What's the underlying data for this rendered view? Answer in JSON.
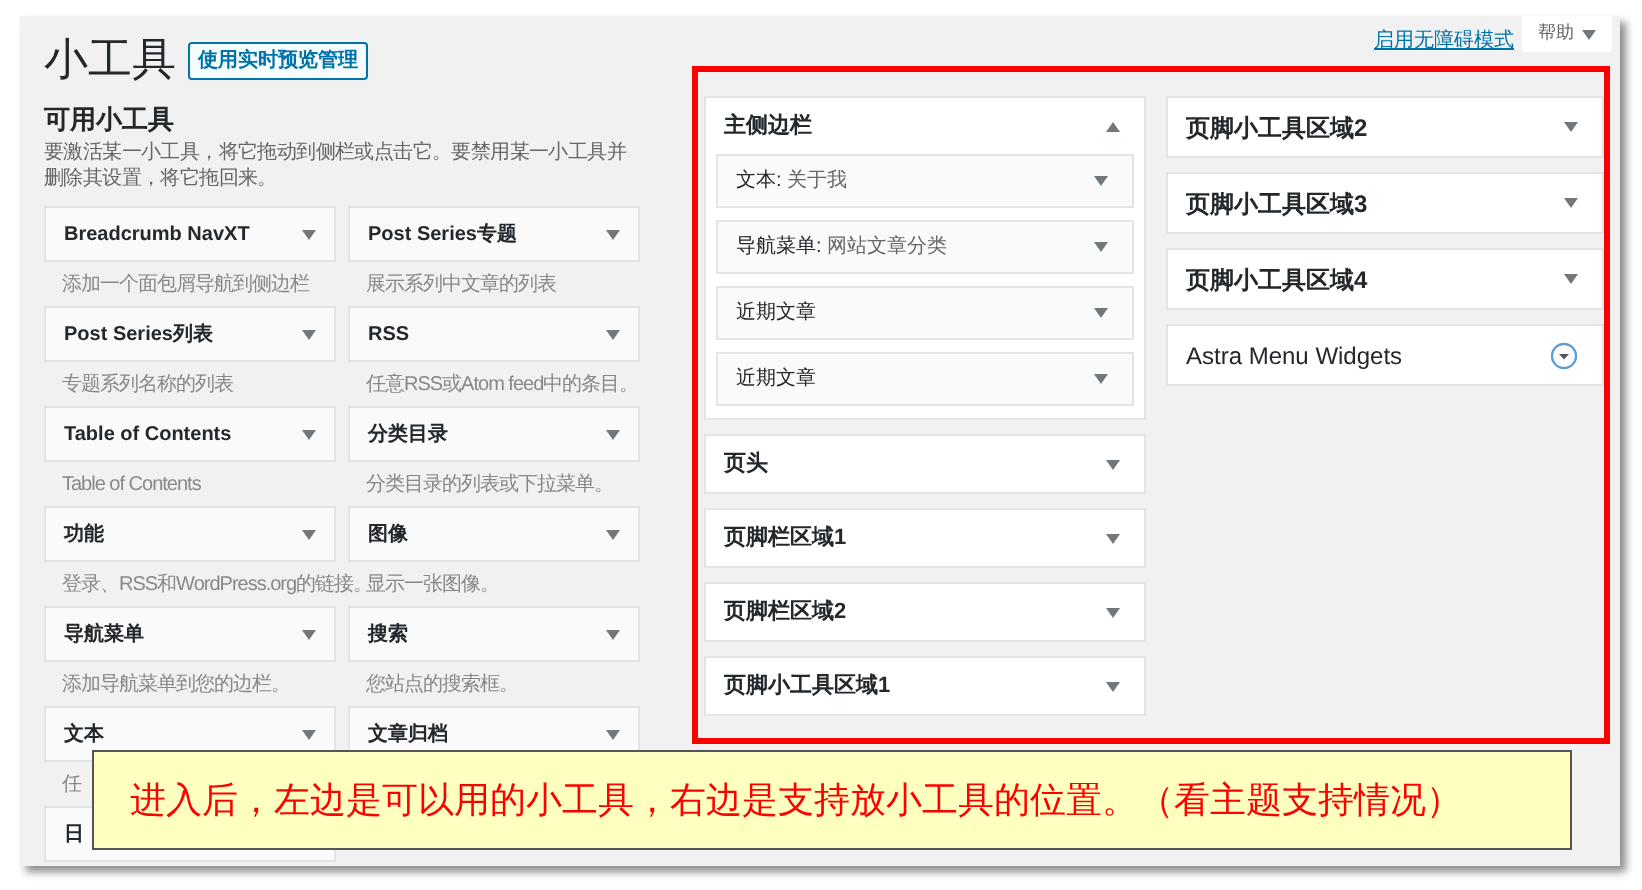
{
  "header": {
    "title": "小工具",
    "manage_button": "使用实时预览管理",
    "accessibility_link": "启用无障碍模式",
    "help_button": "帮助"
  },
  "available": {
    "heading": "可用小工具",
    "description": "要激活某一小工具，将它拖动到侧栏或点击它。要禁用某一小工具并删除其设置，将它拖回来。",
    "widgets": [
      {
        "name": "Breadcrumb NavXT",
        "description": "添加一个面包屑导航到侧边栏"
      },
      {
        "name": "Post Series专题",
        "description": "展示系列中文章的列表"
      },
      {
        "name": "Post Series列表",
        "description": "专题系列名称的列表"
      },
      {
        "name": "RSS",
        "description": "任意RSS或Atom feed中的条目。"
      },
      {
        "name": "Table of Contents",
        "description": "Table of Contents"
      },
      {
        "name": "分类目录",
        "description": "分类目录的列表或下拉菜单。"
      },
      {
        "name": "功能",
        "description": "登录、RSS和WordPress.org的链接。"
      },
      {
        "name": "图像",
        "description": "显示一张图像。"
      },
      {
        "name": "导航菜单",
        "description": "添加导航菜单到您的边栏。"
      },
      {
        "name": "搜索",
        "description": "您站点的搜索框。"
      },
      {
        "name": "文本",
        "description": "任"
      },
      {
        "name": "文章归档"
      },
      {
        "name": "日"
      }
    ]
  },
  "areas": {
    "columns": [
      [
        {
          "title": "主侧边栏",
          "expanded": true,
          "focused": false,
          "items": [
            {
              "type": "文本:",
              "title": "关于我"
            },
            {
              "type": "导航菜单:",
              "title": "网站文章分类"
            },
            {
              "type": "近期文章"
            },
            {
              "type": "近期文章"
            }
          ]
        },
        {
          "title": "页头",
          "expanded": false,
          "focused": false
        },
        {
          "title": "页脚栏区域1",
          "expanded": false,
          "focused": false
        },
        {
          "title": "页脚栏区域2",
          "expanded": false,
          "focused": false
        },
        {
          "title": "页脚小工具区域1",
          "expanded": false,
          "focused": false
        }
      ],
      [
        {
          "title": "页脚小工具区域2",
          "expanded": false,
          "focused": false
        },
        {
          "title": "页脚小工具区域3",
          "expanded": false,
          "focused": false
        },
        {
          "title": "页脚小工具区域4",
          "expanded": false,
          "focused": false
        },
        {
          "title": "Astra Menu Widgets",
          "expanded": false,
          "focused": true
        }
      ]
    ]
  },
  "note": "进入后，左边是可以用的小工具，右边是支持放小工具的位置。（看主题支持情况）"
}
